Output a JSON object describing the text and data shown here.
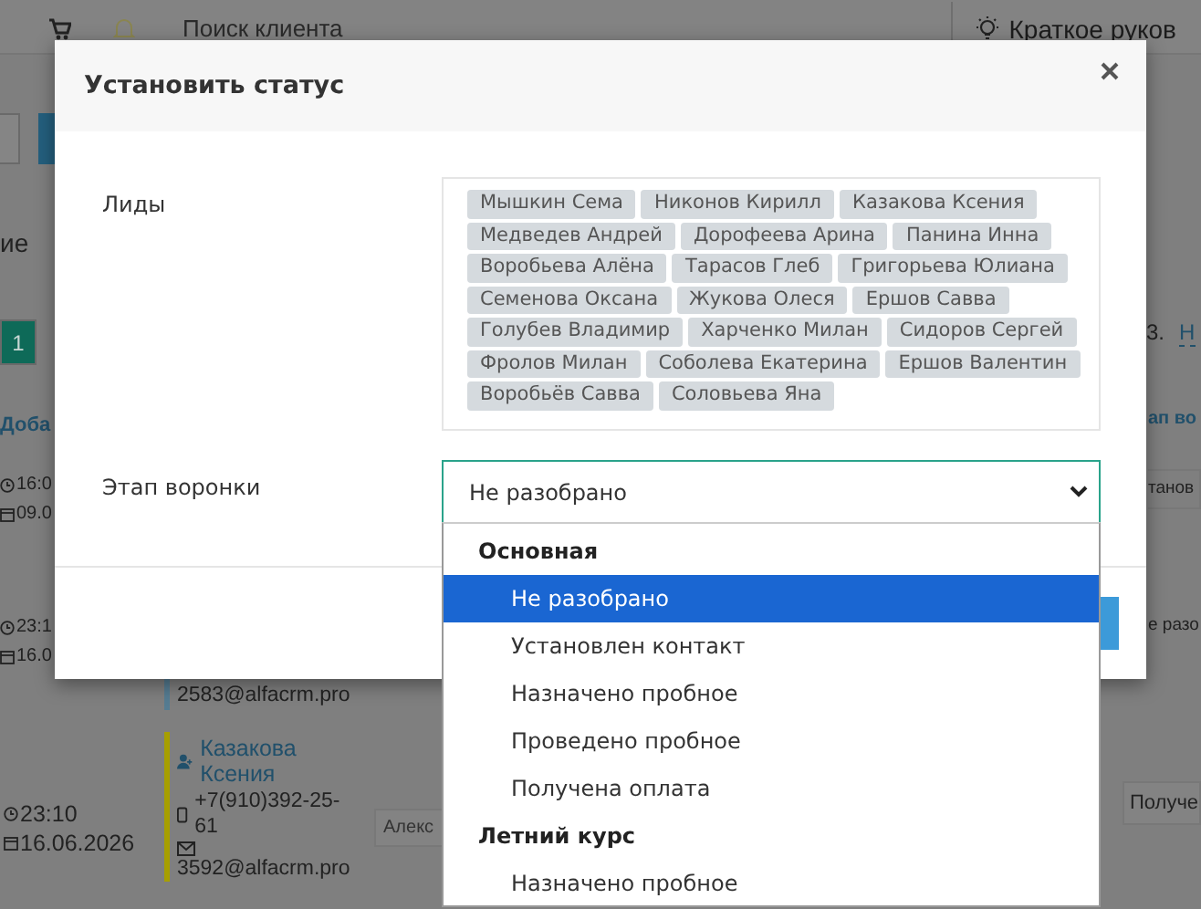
{
  "background": {
    "search": {
      "placeholder": "Поиск клиента"
    },
    "guide_link": "Краткое руков",
    "heading_fragment": "ие",
    "pagination": [
      {
        "label": "1",
        "selected": true
      }
    ],
    "add_link": "Доба",
    "times": [
      {
        "time": "16:0",
        "date": "09.0"
      },
      {
        "time": "23:1",
        "date": "16.0"
      },
      {
        "time": "23:10",
        "date": "16.06.2026"
      }
    ],
    "leads": [
      {
        "email": "2583@alfacrm.pro",
        "color": "#557c92"
      },
      {
        "name": "Казакова Ксения",
        "phone": "+7(910)392-25-61",
        "email": "3592@alfacrm.pro",
        "color": "#a79f00"
      }
    ],
    "responsible_fragment": "Алекс",
    "page_number": "3.",
    "link_fragment": "Н",
    "column_fragment": "ап во",
    "stage_fragments": [
      "танов",
      "е разо",
      "Получе"
    ]
  },
  "modal": {
    "title": "Установить статус",
    "leads_label": "Лиды",
    "leads": [
      "Мышкин Сема",
      "Никонов Кирилл",
      "Казакова Ксения",
      "Медведев Андрей",
      "Дорофеева Арина",
      "Панина Инна",
      "Воробьева Алёна",
      "Тарасов Глеб",
      "Григорьева Юлиана",
      "Семенова Оксана",
      "Жукова Олеся",
      "Ершов Савва",
      "Голубев Владимир",
      "Харченко Милан",
      "Сидоров Сергей",
      "Фролов Милан",
      "Соболева Екатерина",
      "Ершов Валентин",
      "Воробьёв Савва",
      "Соловьева Яна"
    ],
    "stage_label": "Этап воронки",
    "stage_select": {
      "value": "Не разобрано",
      "expanded": true,
      "groups": [
        {
          "label": "Основная",
          "options": [
            {
              "label": "Не разобрано",
              "selected": true
            },
            {
              "label": "Установлен контакт",
              "selected": false
            },
            {
              "label": "Назначено пробное",
              "selected": false
            },
            {
              "label": "Проведено пробное",
              "selected": false
            },
            {
              "label": "Получена оплата",
              "selected": false
            }
          ]
        },
        {
          "label": "Летний курс",
          "options": [
            {
              "label": "Назначено пробное",
              "selected": false
            }
          ]
        }
      ]
    }
  }
}
